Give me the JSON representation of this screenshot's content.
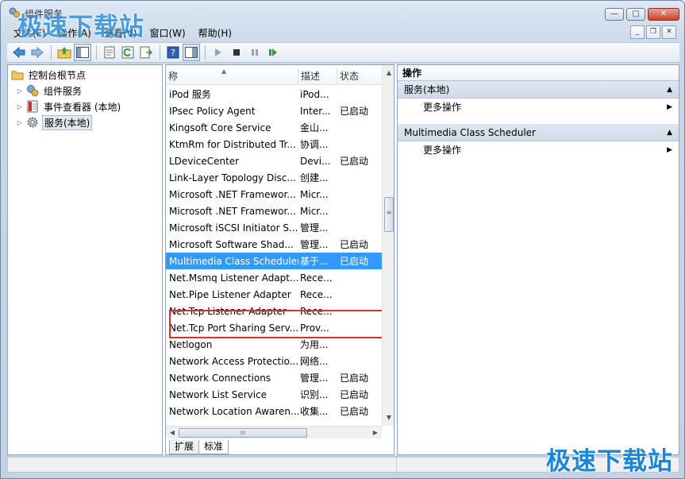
{
  "window": {
    "title": "组件服务",
    "controls": {
      "minimize": "—",
      "maximize": "□",
      "close": "✕"
    }
  },
  "menubar": {
    "items": [
      "文件(F)",
      "操作(A)",
      "查看(V)",
      "窗口(W)",
      "帮助(H)"
    ],
    "mdi_controls": {
      "minimize": "_",
      "restore": "❐",
      "close": "✕"
    }
  },
  "toolbar": {
    "buttons": [
      "back-icon",
      "forward-icon",
      "up-folder-icon",
      "show-hide-tree-icon",
      "properties-icon",
      "refresh-icon",
      "export-list-icon",
      "help-icon",
      "show-hide-action-pane-icon",
      "play-icon",
      "stop-icon",
      "pause-icon",
      "restart-icon"
    ]
  },
  "tree": {
    "root": "控制台根节点",
    "items": [
      {
        "label": "组件服务",
        "icon": "component-services-icon"
      },
      {
        "label": "事件查看器 (本地)",
        "icon": "event-viewer-icon"
      },
      {
        "label": "服务(本地)",
        "icon": "services-gear-icon"
      }
    ]
  },
  "list": {
    "columns": {
      "name": "称",
      "desc": "描述",
      "status": "状态"
    },
    "rows": [
      {
        "name": "iPod 服务",
        "desc": "iPod...",
        "status": ""
      },
      {
        "name": "IPsec Policy Agent",
        "desc": "Inter...",
        "status": "已启动"
      },
      {
        "name": "Kingsoft Core Service",
        "desc": "金山...",
        "status": ""
      },
      {
        "name": "KtmRm for Distributed Tr...",
        "desc": "协调...",
        "status": ""
      },
      {
        "name": "LDeviceCenter",
        "desc": "Devi...",
        "status": "已启动"
      },
      {
        "name": "Link-Layer Topology Disc...",
        "desc": "创建...",
        "status": ""
      },
      {
        "name": "Microsoft .NET Framewor...",
        "desc": "Micr...",
        "status": ""
      },
      {
        "name": "Microsoft .NET Framewor...",
        "desc": "Micr...",
        "status": ""
      },
      {
        "name": "Microsoft iSCSI Initiator S...",
        "desc": "管理...",
        "status": ""
      },
      {
        "name": "Microsoft Software Shad...",
        "desc": "管理...",
        "status": "已启动"
      },
      {
        "name": "Multimedia Class Scheduler",
        "desc": "基于...",
        "status": "已启动",
        "selected": true
      },
      {
        "name": "Net.Msmq Listener Adapt...",
        "desc": "Rece...",
        "status": ""
      },
      {
        "name": "Net.Pipe Listener Adapter",
        "desc": "Rece...",
        "status": ""
      },
      {
        "name": "Net.Tcp Listener Adapter",
        "desc": "Rece...",
        "status": ""
      },
      {
        "name": "Net.Tcp Port Sharing Serv...",
        "desc": "Prov...",
        "status": ""
      },
      {
        "name": "Netlogon",
        "desc": "为用...",
        "status": ""
      },
      {
        "name": "Network Access Protectio...",
        "desc": "网络...",
        "status": ""
      },
      {
        "name": "Network Connections",
        "desc": "管理...",
        "status": "已启动"
      },
      {
        "name": "Network List Service",
        "desc": "识别...",
        "status": "已启动"
      },
      {
        "name": "Network Location Awaren...",
        "desc": "收集...",
        "status": "已启动"
      }
    ],
    "tabs": [
      "扩展",
      "标准"
    ],
    "scroll_arrows": {
      "up": "▲",
      "down": "▼",
      "left": "◀",
      "right": "▶",
      "grip": "≡",
      "hgrip": "III"
    }
  },
  "actions": {
    "title": "操作",
    "sections": [
      {
        "header": "服务(本地)",
        "item": "更多操作"
      },
      {
        "header": "Multimedia Class Scheduler",
        "item": "更多操作"
      }
    ]
  },
  "watermark": {
    "text": "极速下载站"
  },
  "colors": {
    "selection": "#3399ff",
    "highlight_box": "#d9302b",
    "watermark": "#1c86d6"
  }
}
